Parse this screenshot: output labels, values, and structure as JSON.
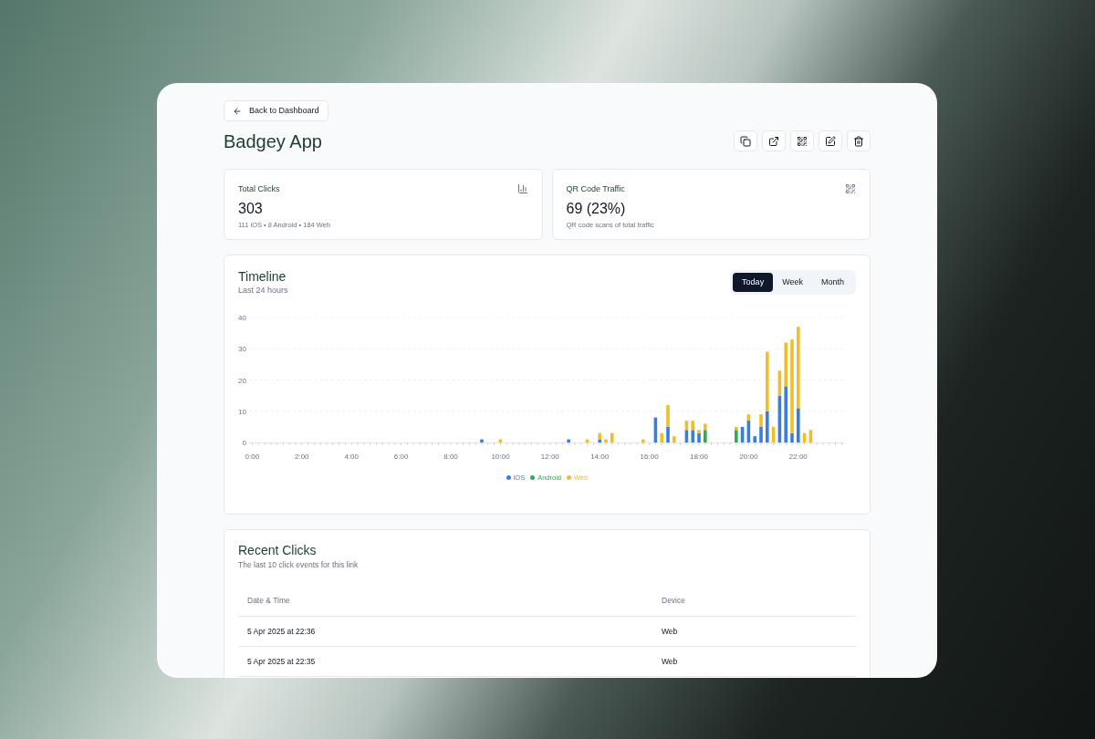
{
  "back_button": {
    "label": "Back to Dashboard"
  },
  "title": "Badgey App",
  "actions": [
    {
      "kind": "copy"
    },
    {
      "kind": "external"
    },
    {
      "kind": "qr"
    },
    {
      "kind": "edit"
    },
    {
      "kind": "delete"
    }
  ],
  "stats": [
    {
      "kind": "chart",
      "label": "Total Clicks",
      "value": "303",
      "detail": "111 iOS • 8 Android • 184 Web"
    },
    {
      "kind": "qr",
      "label": "QR Code Traffic",
      "value": "69 (23%)",
      "detail": "QR code scans of total traffic"
    }
  ],
  "timeline": {
    "title": "Timeline",
    "subtitle": "Last 24 hours",
    "ranges": [
      {
        "label": "Today",
        "selected": true
      },
      {
        "label": "Week",
        "selected": false
      },
      {
        "label": "Month",
        "selected": false
      }
    ],
    "chart_data": {
      "type": "bar",
      "stacked": true,
      "ylim": [
        0,
        40
      ],
      "yticks": [
        0,
        10,
        20,
        30,
        40
      ],
      "grid": true,
      "xlim": [
        -0.125,
        23.875
      ],
      "xticks": [
        {
          "value": 0,
          "label": "0:00"
        },
        {
          "value": 2,
          "label": "2:00"
        },
        {
          "value": 4,
          "label": "4:00"
        },
        {
          "value": 6,
          "label": "6:00"
        },
        {
          "value": 8,
          "label": "8:00"
        },
        {
          "value": 10,
          "label": "10:00"
        },
        {
          "value": 12,
          "label": "12:00"
        },
        {
          "value": 14,
          "label": "14:00"
        },
        {
          "value": 16,
          "label": "16:00"
        },
        {
          "value": 18,
          "label": "18:00"
        },
        {
          "value": 20,
          "label": "20:00"
        },
        {
          "value": 22,
          "label": "22:00"
        }
      ],
      "x": [
        0,
        0.25,
        0.5,
        0.75,
        1,
        1.25,
        1.5,
        1.75,
        2,
        2.25,
        2.5,
        2.75,
        3,
        3.25,
        3.5,
        3.75,
        4,
        4.25,
        4.5,
        4.75,
        5,
        5.25,
        5.5,
        5.75,
        6,
        6.25,
        6.5,
        6.75,
        7,
        7.25,
        7.5,
        7.75,
        8,
        8.25,
        8.5,
        8.75,
        9,
        9.25,
        9.5,
        9.75,
        10,
        10.25,
        10.5,
        10.75,
        11,
        11.25,
        11.5,
        11.75,
        12,
        12.25,
        12.5,
        12.75,
        13,
        13.25,
        13.5,
        13.75,
        14,
        14.25,
        14.5,
        14.75,
        15,
        15.25,
        15.5,
        15.75,
        16,
        16.25,
        16.5,
        16.75,
        17,
        17.25,
        17.5,
        17.75,
        18,
        18.25,
        18.5,
        18.75,
        19,
        19.25,
        19.5,
        19.75,
        20,
        20.25,
        20.5,
        20.75,
        21,
        21.25,
        21.5,
        21.75,
        22,
        22.25,
        22.5,
        22.75,
        23,
        23.25,
        23.5,
        23.75
      ],
      "series": [
        {
          "name": "iOS",
          "color": "#3b7ddd",
          "values": [
            0,
            0,
            0,
            0,
            0,
            0,
            0,
            0,
            0,
            0,
            0,
            0,
            0,
            0,
            0,
            0,
            0,
            0,
            0,
            0,
            0,
            0,
            0,
            0,
            0,
            0,
            0,
            0,
            0,
            0,
            0,
            0,
            0,
            0,
            0,
            0,
            0,
            1,
            0,
            0,
            0,
            0,
            0,
            0,
            0,
            0,
            0,
            0,
            0,
            0,
            0,
            1,
            0,
            0,
            0,
            0,
            1,
            0,
            0,
            0,
            0,
            0,
            0,
            0,
            0,
            8,
            0,
            5,
            0,
            0,
            4,
            4,
            3,
            0,
            0,
            0,
            0,
            0,
            0,
            5,
            7,
            2,
            5,
            10,
            0,
            15,
            18,
            3,
            11,
            0,
            0,
            0,
            0,
            0,
            0,
            0
          ]
        },
        {
          "name": "Android",
          "color": "#34a853",
          "values": [
            0,
            0,
            0,
            0,
            0,
            0,
            0,
            0,
            0,
            0,
            0,
            0,
            0,
            0,
            0,
            0,
            0,
            0,
            0,
            0,
            0,
            0,
            0,
            0,
            0,
            0,
            0,
            0,
            0,
            0,
            0,
            0,
            0,
            0,
            0,
            0,
            0,
            0,
            0,
            0,
            0,
            0,
            0,
            0,
            0,
            0,
            0,
            0,
            0,
            0,
            0,
            0,
            0,
            0,
            0,
            0,
            0,
            0,
            0,
            0,
            0,
            0,
            0,
            0,
            0,
            0,
            0,
            0,
            0,
            0,
            0,
            0,
            0,
            4,
            0,
            0,
            0,
            0,
            4,
            0,
            0,
            0,
            0,
            0,
            0,
            0,
            0,
            0,
            0,
            0,
            0,
            0,
            0,
            0,
            0,
            0
          ]
        },
        {
          "name": "Web",
          "color": "#f2bd2b",
          "values": [
            0,
            0,
            0,
            0,
            0,
            0,
            0,
            0,
            0,
            0,
            0,
            0,
            0,
            0,
            0,
            0,
            0,
            0,
            0,
            0,
            0,
            0,
            0,
            0,
            0,
            0,
            0,
            0,
            0,
            0,
            0,
            0,
            0,
            0,
            0,
            0,
            0,
            0,
            0,
            0,
            1,
            0,
            0,
            0,
            0,
            0,
            0,
            0,
            0,
            0,
            0,
            0,
            0,
            0,
            1,
            0,
            2,
            1,
            3,
            0,
            0,
            0,
            0,
            1,
            0,
            0,
            3,
            7,
            2,
            0,
            3,
            3,
            1,
            2,
            0,
            0,
            0,
            0,
            1,
            0,
            2,
            0,
            4,
            19,
            5,
            8,
            14,
            30,
            26,
            3,
            4,
            0,
            0,
            0,
            0,
            0
          ]
        }
      ]
    }
  },
  "recent": {
    "title": "Recent Clicks",
    "subtitle": "The last 10 click events for this link",
    "columns": [
      "Date & Time",
      "Device"
    ],
    "rows": [
      [
        "5 Apr 2025 at 22:36",
        "Web"
      ],
      [
        "5 Apr 2025 at 22:35",
        "Web"
      ]
    ]
  }
}
